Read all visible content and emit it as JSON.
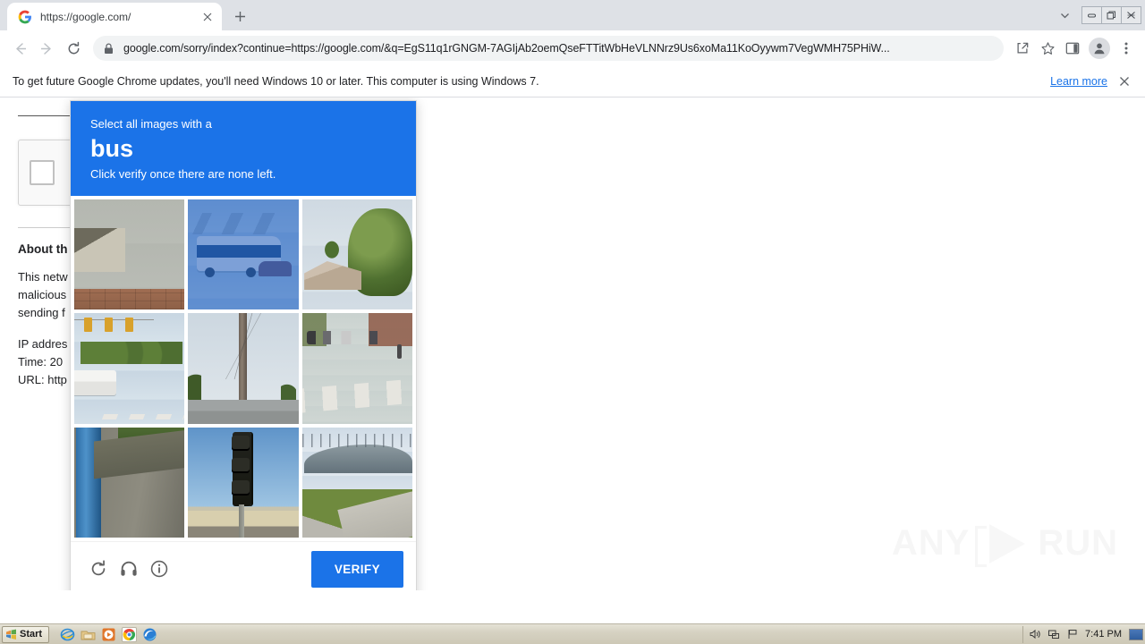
{
  "browser": {
    "tab": {
      "title": "https://google.com/",
      "favicon_icon": "google-g-icon",
      "close_icon": "close-icon"
    },
    "new_tab_icon": "plus-icon",
    "tab_search_icon": "chevron-down-icon",
    "window_controls": {
      "minimize_icon": "minimize-icon",
      "restore_icon": "restore-icon",
      "close_icon": "close-icon"
    },
    "toolbar": {
      "back_icon": "arrow-left-icon",
      "forward_icon": "arrow-right-icon",
      "reload_icon": "reload-icon",
      "lock_icon": "lock-icon",
      "url": "google.com/sorry/index?continue=https://google.com/&q=EgS11q1rGNGM-7AGIjAb2oemQseFTTitWbHeVLNNrz9Us6xoMa11KoOyywm7VegWMH75PHiW...",
      "url_host": "google.com",
      "url_path": "/sorry/index?continue=https://google.com/&q=EgS11q1rGNGM-7AGIjAb2oemQseFTTitWbHeVLNNrz9Us6xoMa11KoOyywm7VegWMH75PHiW...",
      "share_icon": "share-icon",
      "bookmark_icon": "star-icon",
      "side_panel_icon": "side-panel-icon",
      "profile_icon": "avatar-icon",
      "menu_icon": "three-dot-menu-icon"
    }
  },
  "infobar": {
    "message": "To get future Google Chrome updates, you'll need Windows 10 or later. This computer is using Windows 7.",
    "link_label": "Learn more",
    "close_icon": "close-icon"
  },
  "page": {
    "about_heading": "About th",
    "paragraph_lines": [
      "This netw",
      "malicious",
      "sending f"
    ],
    "meta_lines": [
      "IP addres",
      "Time: 20",
      "URL: http"
    ]
  },
  "recaptcha": {
    "header": {
      "instruction_prefix": "Select all images with a",
      "target": "bus",
      "instruction_suffix": "Click verify once there are none left."
    },
    "header_color": "#1b73e8",
    "verify_button_color": "#1b73e8",
    "tiles": [
      {
        "index": 1,
        "name": "house-block-wall",
        "scene": "scene-house-wall",
        "selected": false
      },
      {
        "index": 2,
        "name": "blue-coach-bus",
        "scene": "scene-bus-blue",
        "selected": true
      },
      {
        "index": 3,
        "name": "house-with-trees",
        "scene": "scene-house-trees",
        "selected": false
      },
      {
        "index": 4,
        "name": "white-bus-intersection",
        "scene": "scene-bus-white",
        "selected": false
      },
      {
        "index": 5,
        "name": "utility-pole",
        "scene": "scene-pole",
        "selected": false
      },
      {
        "index": 6,
        "name": "crosswalk-street",
        "scene": "scene-crosswalk",
        "selected": false
      },
      {
        "index": 7,
        "name": "blue-lamp-post",
        "scene": "scene-blue-pole",
        "selected": false
      },
      {
        "index": 8,
        "name": "traffic-light",
        "scene": "scene-traffic",
        "selected": false
      },
      {
        "index": 9,
        "name": "highway-overpass",
        "scene": "scene-bridge",
        "selected": false
      }
    ],
    "footer": {
      "reload_icon": "reload-icon",
      "audio_icon": "headphones-icon",
      "help_icon": "info-icon",
      "verify_label": "VERIFY"
    }
  },
  "watermark": {
    "text_left": "ANY",
    "text_right": "RUN"
  },
  "taskbar": {
    "start_label": "Start",
    "quick_launch": [
      {
        "name": "internet-explorer-icon"
      },
      {
        "name": "file-explorer-icon"
      },
      {
        "name": "media-player-icon"
      },
      {
        "name": "google-chrome-icon"
      },
      {
        "name": "microsoft-edge-icon"
      }
    ],
    "tray": {
      "volume_icon": "volume-icon",
      "network_icon": "network-icon",
      "flag_icon": "action-center-flag-icon",
      "time": "7:41 PM",
      "show_desktop_icon": "show-desktop-icon"
    }
  }
}
